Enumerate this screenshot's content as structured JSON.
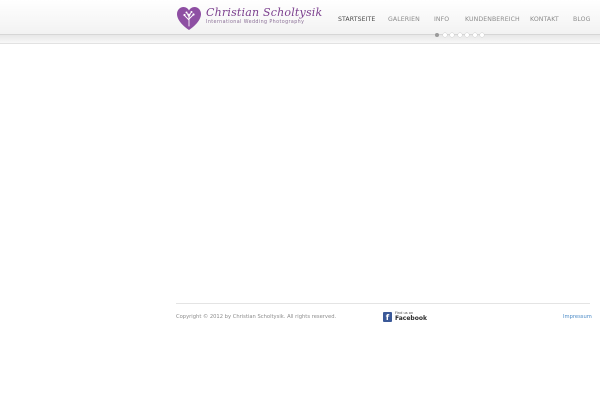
{
  "logo": {
    "name": "Christian Scholtysik",
    "tagline": "International Wedding Photography",
    "brand_color": "#7b3f8e",
    "icon": "tree-heart-icon"
  },
  "nav": {
    "items": [
      {
        "label": "STARTSEITE",
        "active": true
      },
      {
        "label": "GALERIEN",
        "active": false
      },
      {
        "label": "INFO",
        "active": false
      },
      {
        "label": "KUNDENBEREICH",
        "active": false
      },
      {
        "label": "KONTAKT",
        "active": false
      },
      {
        "label": "BLOG",
        "active": false
      }
    ]
  },
  "slider": {
    "slide_count": 7,
    "active_index": 0
  },
  "footer": {
    "copyright": "Copyright © 2012 by Christian Scholtysik. All rights reserved.",
    "facebook": {
      "small": "Find us on",
      "big": "Facebook",
      "icon": "facebook-icon",
      "color": "#3b5998"
    },
    "impressum": "Impressum",
    "link_color": "#4b8bc7"
  }
}
